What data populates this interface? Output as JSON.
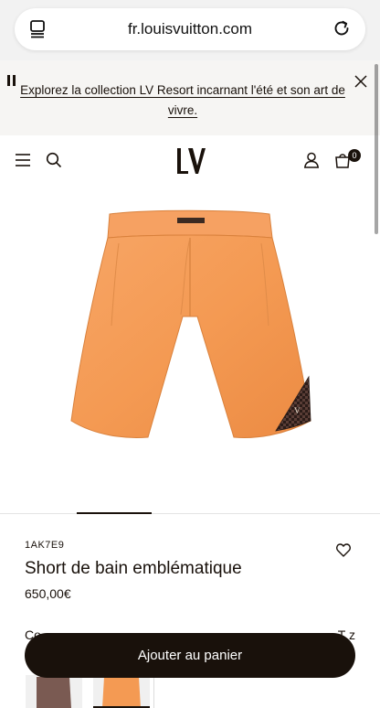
{
  "browser": {
    "url": "fr.louisvuitton.com"
  },
  "promo": {
    "text": "Explorez la collection LV Resort incarnant l'été et son art de vivre."
  },
  "header": {
    "logo": "LV",
    "cart_count": "0"
  },
  "product": {
    "sku": "1AK7E9",
    "name": "Short de bain emblématique",
    "price": "650,00€",
    "color_label": "Co",
    "size_link": "T   z"
  },
  "cta": {
    "add_to_cart": "Ajouter au panier"
  },
  "colors": {
    "primary": "#19110b",
    "product_orange": "#f49a53",
    "banner_bg": "#f6f5f3"
  },
  "icons": [
    "tabs-icon",
    "reload-icon",
    "pause-icon",
    "close-icon",
    "menu-icon",
    "search-icon",
    "account-icon",
    "shopping-bag-icon",
    "heart-icon"
  ]
}
